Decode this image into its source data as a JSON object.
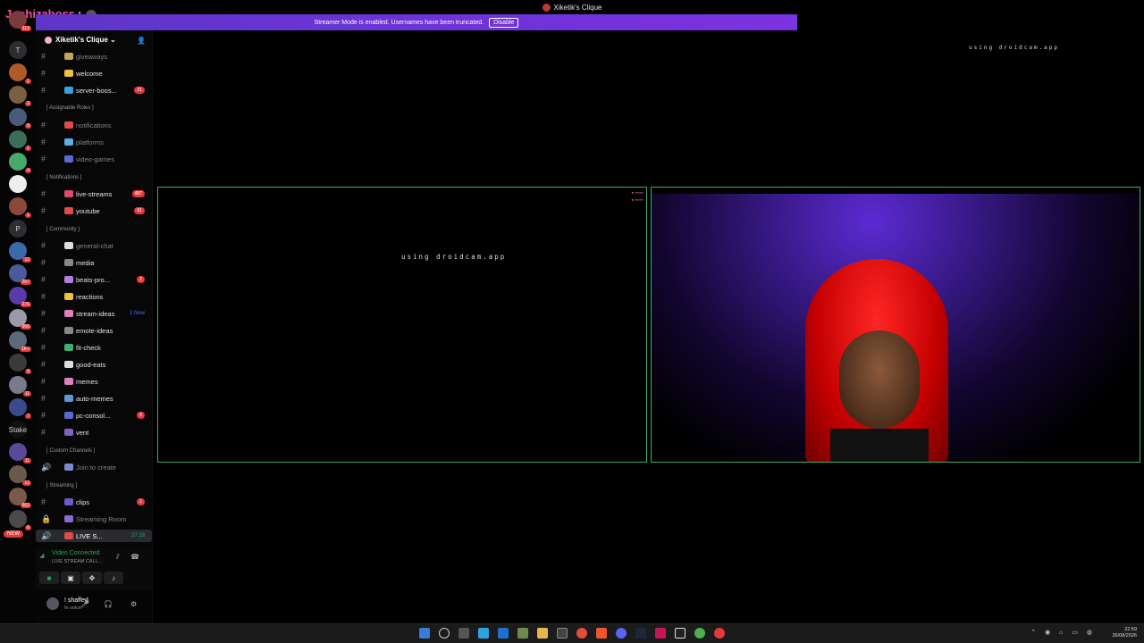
{
  "window": {
    "title": "Xiketik's Clique"
  },
  "overlay": {
    "username": "Joshizaboss"
  },
  "banner": {
    "text": "Streamer Mode is enabled. Usernames have been truncated.",
    "disable_label": "Disable"
  },
  "rail": {
    "servers": [
      {
        "label": "",
        "count": "113"
      },
      {
        "label": "T",
        "count": ""
      },
      {
        "label": "",
        "count": "1"
      },
      {
        "label": "",
        "count": "3"
      },
      {
        "label": "",
        "count": "9"
      },
      {
        "label": "",
        "count": "1"
      },
      {
        "label": "",
        "count": "4"
      },
      {
        "label": "",
        "count": ""
      },
      {
        "label": "",
        "count": "1"
      },
      {
        "label": "P",
        "count": ""
      },
      {
        "label": "",
        "count": "12"
      },
      {
        "label": "",
        "count": "267"
      },
      {
        "label": "",
        "count": "276"
      },
      {
        "label": "",
        "count": "906"
      },
      {
        "label": "",
        "count": "1K+"
      },
      {
        "label": "",
        "count": "9"
      },
      {
        "label": "",
        "count": "11"
      },
      {
        "label": "",
        "count": "7"
      },
      {
        "label": "Stake",
        "count": ""
      },
      {
        "label": "",
        "count": "11"
      },
      {
        "label": "",
        "count": "12"
      },
      {
        "label": "",
        "count": "662"
      },
      {
        "label": "",
        "count": "6"
      }
    ],
    "new_label": "NEW"
  },
  "sidebar": {
    "server_name": "Xiketik's Clique",
    "categories": {
      "roles": "[ Assignable Roles ]",
      "notifications": "[ Notifications ]",
      "community": "[ Community ]",
      "custom": "[ Custom Channels ]",
      "streaming": "[ Streaming ]"
    },
    "channels": [
      {
        "name": "giveaways",
        "badge": ""
      },
      {
        "name": "welcome",
        "badge": ""
      },
      {
        "name": "server-boos...",
        "badge": "21"
      },
      {
        "name": "notifications",
        "badge": ""
      },
      {
        "name": "platforms",
        "badge": ""
      },
      {
        "name": "video-games",
        "badge": ""
      },
      {
        "name": "live-streams",
        "badge": "487"
      },
      {
        "name": "youtube",
        "badge": "61"
      },
      {
        "name": "general-chat",
        "badge": ""
      },
      {
        "name": "media",
        "badge": ""
      },
      {
        "name": "beats-pro...",
        "badge": "2"
      },
      {
        "name": "reactions",
        "badge": ""
      },
      {
        "name": "stream-ideas",
        "badge": "2 New"
      },
      {
        "name": "emote-ideas",
        "badge": ""
      },
      {
        "name": "fit-check",
        "badge": ""
      },
      {
        "name": "good-eats",
        "badge": ""
      },
      {
        "name": "memes",
        "badge": ""
      },
      {
        "name": "auto-memes",
        "badge": ""
      },
      {
        "name": "pc-consol...",
        "badge": "6"
      },
      {
        "name": "vent",
        "badge": ""
      },
      {
        "name": "Join to create",
        "badge": ""
      },
      {
        "name": "clips",
        "badge": "1"
      },
      {
        "name": "Streaming Room",
        "badge": ""
      },
      {
        "name": "LIVE S...",
        "badge": "27:18"
      }
    ]
  },
  "voice": {
    "status": "Video Connected",
    "channel": "LIVE STREAM CALL..."
  },
  "user": {
    "name": "! shaffed",
    "status": "In voice"
  },
  "stage": {
    "droidcam_text": "using droidcam.app"
  },
  "tray": {
    "time": "22:59",
    "date": "26/08/2026"
  }
}
